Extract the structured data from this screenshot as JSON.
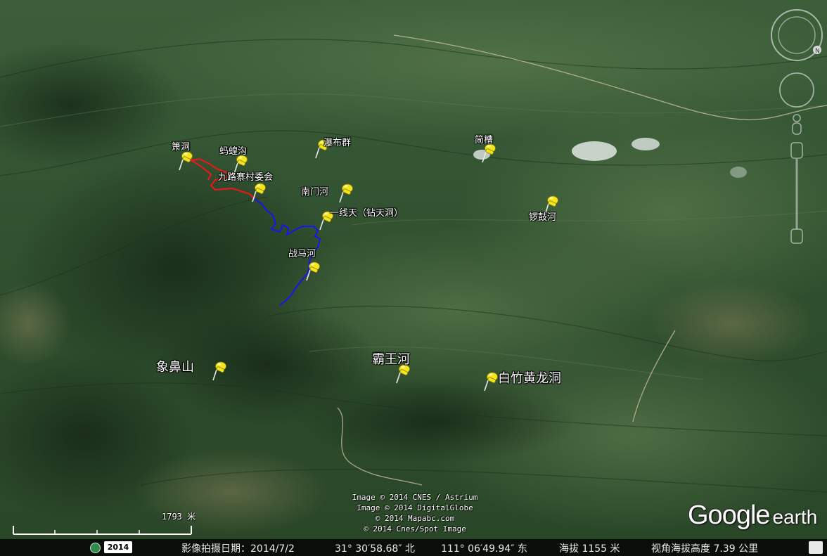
{
  "placemarks": [
    {
      "label": "箫洞",
      "size": "small"
    },
    {
      "label": "蚂蝗沟",
      "size": "small"
    },
    {
      "label": "瀑布群",
      "size": "small"
    },
    {
      "label": "九路寨村委会",
      "size": "small"
    },
    {
      "label": "南门河",
      "size": "small"
    },
    {
      "label": "一线天（钻天洞）",
      "size": "small"
    },
    {
      "label": "简槽",
      "size": "small"
    },
    {
      "label": "锣鼓河",
      "size": "small"
    },
    {
      "label": "战马河",
      "size": "small"
    },
    {
      "label": "象鼻山",
      "size": "large"
    },
    {
      "label": "霸王河",
      "size": "large"
    },
    {
      "label": "白竹黄龙洞",
      "size": "large"
    }
  ],
  "credits": [
    "Image © 2014 CNES / Astrium",
    "Image © 2014 DigitalGlobe",
    "© 2014 Mapabc.com",
    "© 2014 Cnes/Spot Image"
  ],
  "scale": {
    "label": "1793 米"
  },
  "logo": {
    "google": "Google",
    "earth": "earth"
  },
  "status": {
    "year": "2014",
    "date": "影像拍摄日期：2014/7/2",
    "lat": "31° 30′58.68″ 北",
    "lon": "111° 06′49.94″ 东",
    "elevation": "海拔  1155 米",
    "eye_alt": "视角海拔高度    7.39 公里"
  },
  "colors": {
    "route_red": "#e31a1a",
    "route_blue": "#1515ee",
    "pin": "#f3e51e"
  }
}
